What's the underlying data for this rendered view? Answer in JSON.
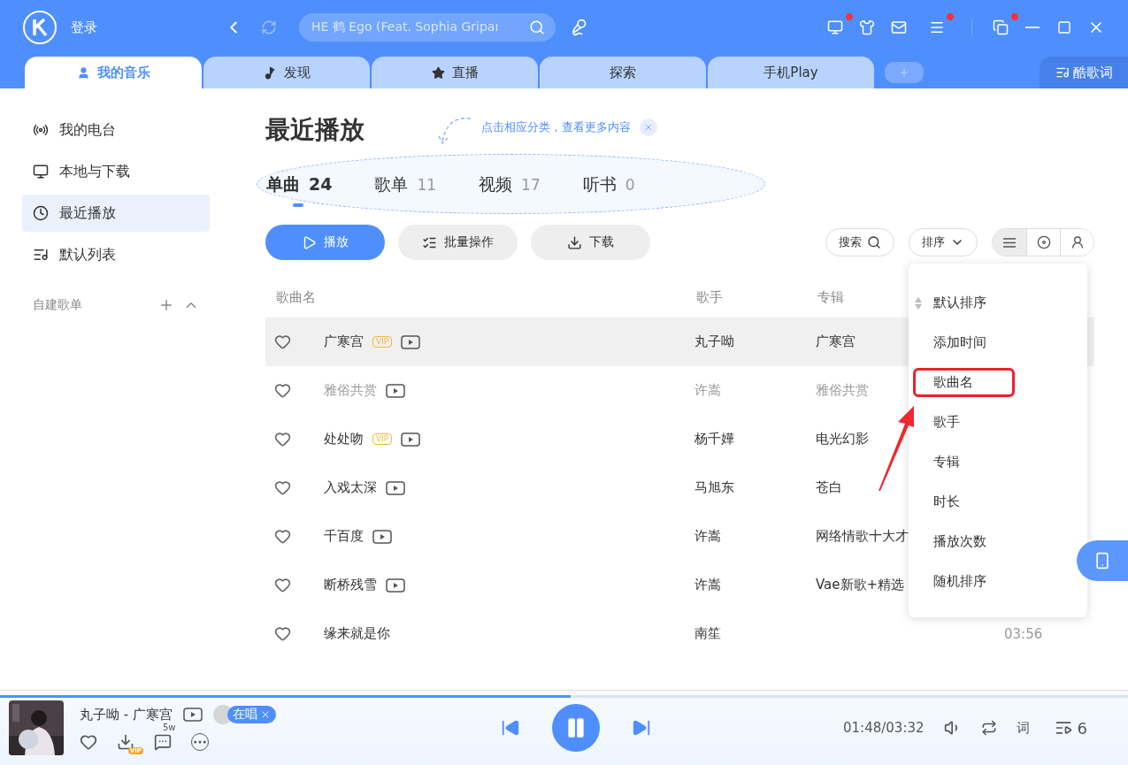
{
  "titlebar": {
    "login": "登录",
    "search": {
      "value": "HE 鹤 Ego (Feat. Sophia Gripaı"
    }
  },
  "tabs": [
    {
      "label": "我的音乐",
      "selected": true
    },
    {
      "label": "发现",
      "selected": false
    },
    {
      "label": "直播",
      "selected": false
    },
    {
      "label": "探索",
      "selected": false
    },
    {
      "label": "手机Play",
      "selected": false
    }
  ],
  "lyrics_button": "酷歌词",
  "sidebar": {
    "items": [
      {
        "label": "我的电台",
        "selected": false
      },
      {
        "label": "本地与下载",
        "selected": false
      },
      {
        "label": "最近播放",
        "selected": true
      },
      {
        "label": "默认列表",
        "selected": false
      }
    ],
    "section": "自建歌单"
  },
  "page": {
    "title": "最近播放",
    "hint": "点击相应分类，查看更多内容",
    "categories": [
      {
        "label": "单曲",
        "count": "24",
        "selected": true
      },
      {
        "label": "歌单",
        "count": "11",
        "selected": false
      },
      {
        "label": "视频",
        "count": "17",
        "selected": false
      },
      {
        "label": "听书",
        "count": "0",
        "selected": false
      }
    ],
    "actions": [
      {
        "label": "播放",
        "kind": "primary"
      },
      {
        "label": "批量操作",
        "kind": "batch"
      },
      {
        "label": "下载",
        "kind": "download"
      }
    ],
    "search_button": "搜索",
    "sort_button": "排序",
    "views": [
      {
        "kind": "list",
        "selected": true
      },
      {
        "kind": "disc",
        "selected": false
      },
      {
        "kind": "person",
        "selected": false
      }
    ]
  },
  "table": {
    "columns": [
      "歌曲名",
      "歌手",
      "专辑"
    ],
    "rows": [
      {
        "title": "广寒宫",
        "vip": "VIP",
        "mv": true,
        "artist": "丸子呦",
        "album": "广寒宫",
        "disabled": false,
        "hovered": true
      },
      {
        "title": "雅俗共赏",
        "mv": true,
        "artist": "许嵩",
        "album": "雅俗共赏",
        "disabled": true,
        "hovered": false
      },
      {
        "title": "处处吻",
        "vip": "VIP",
        "mv": true,
        "artist": "杨千嬅",
        "album": "电光幻影",
        "disabled": false,
        "hovered": false
      },
      {
        "title": "入戏太深",
        "mv": true,
        "artist": "马旭东",
        "album": "苍白",
        "disabled": false,
        "hovered": false
      },
      {
        "title": "千百度",
        "mv": true,
        "artist": "许嵩",
        "album": "网络情歌十大才",
        "disabled": false,
        "hovered": false
      },
      {
        "title": "断桥残雪",
        "mv": true,
        "artist": "许嵩",
        "album": "Vae新歌+精选",
        "disabled": false,
        "hovered": false
      },
      {
        "title": "缘来就是你",
        "mv": false,
        "artist": "南笙",
        "duration": "03:56",
        "disabled": false,
        "hovered": false
      }
    ]
  },
  "sort_menu": [
    {
      "label": "默认排序",
      "selected": true,
      "annotated": false
    },
    {
      "label": "添加时间",
      "selected": false,
      "annotated": false
    },
    {
      "label": "歌曲名",
      "selected": false,
      "annotated": true
    },
    {
      "label": "歌手",
      "selected": false,
      "annotated": false
    },
    {
      "label": "专辑",
      "selected": false,
      "annotated": false
    },
    {
      "label": "时长",
      "selected": false,
      "annotated": false
    },
    {
      "label": "播放次数",
      "selected": false,
      "annotated": false
    },
    {
      "label": "随机排序",
      "selected": false,
      "annotated": false
    }
  ],
  "player": {
    "track": "丸子呦 - 广寒宫",
    "singing": "在唱",
    "comments": "5w",
    "vip_badge": "VIP",
    "level": 0.506,
    "playing": true,
    "time": "01:48/03:32",
    "lyric": "词",
    "queue": "6"
  }
}
